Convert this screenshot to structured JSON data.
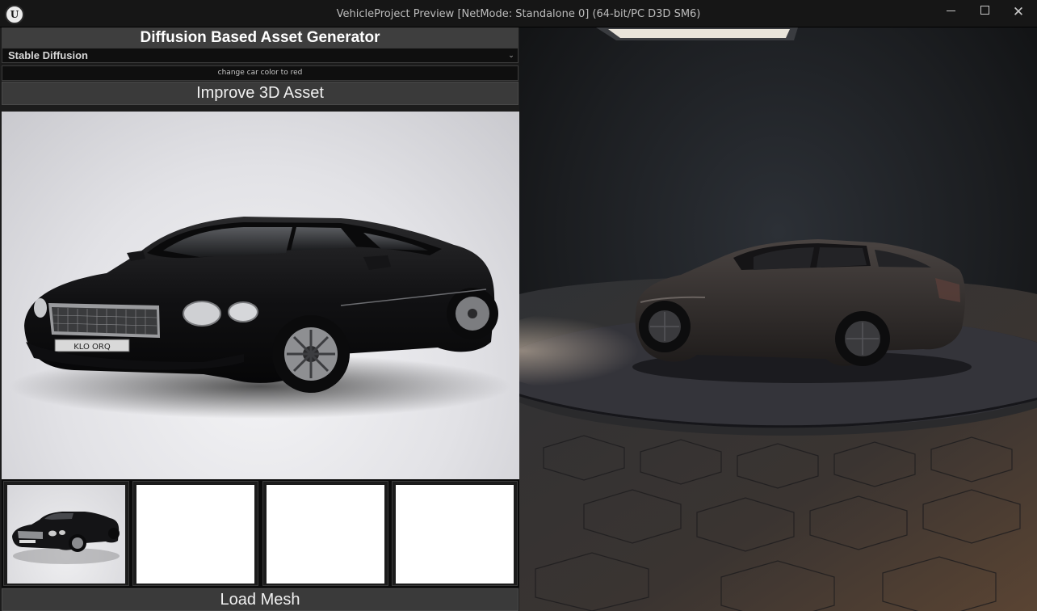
{
  "window": {
    "title": "VehicleProject Preview [NetMode: Standalone 0]  (64-bit/PC D3D SM6)",
    "logo_icon": "unreal-engine-logo",
    "controls": [
      "minimize-icon",
      "maximize-icon",
      "close-icon"
    ]
  },
  "panel": {
    "header": "Diffusion Based Asset Generator",
    "model_select": {
      "selected": "Stable Diffusion",
      "icon": "chevron-down-icon"
    },
    "prompt": {
      "value": "change car color to red"
    },
    "improve_button": "Improve 3D Asset",
    "main_image": {
      "plate_text": "KLO ORQ"
    },
    "thumbnails": [
      {
        "state": "car-image"
      },
      {
        "state": "empty"
      },
      {
        "state": "empty"
      },
      {
        "state": "empty"
      }
    ],
    "load_button": "Load Mesh"
  },
  "viewport": {
    "scene": "3d-car-on-turntable"
  },
  "colors": {
    "titlebar": "#161616",
    "panel_header": "#3e3e3e",
    "button": "#3a3a3a",
    "field": "#0f0f0f"
  }
}
